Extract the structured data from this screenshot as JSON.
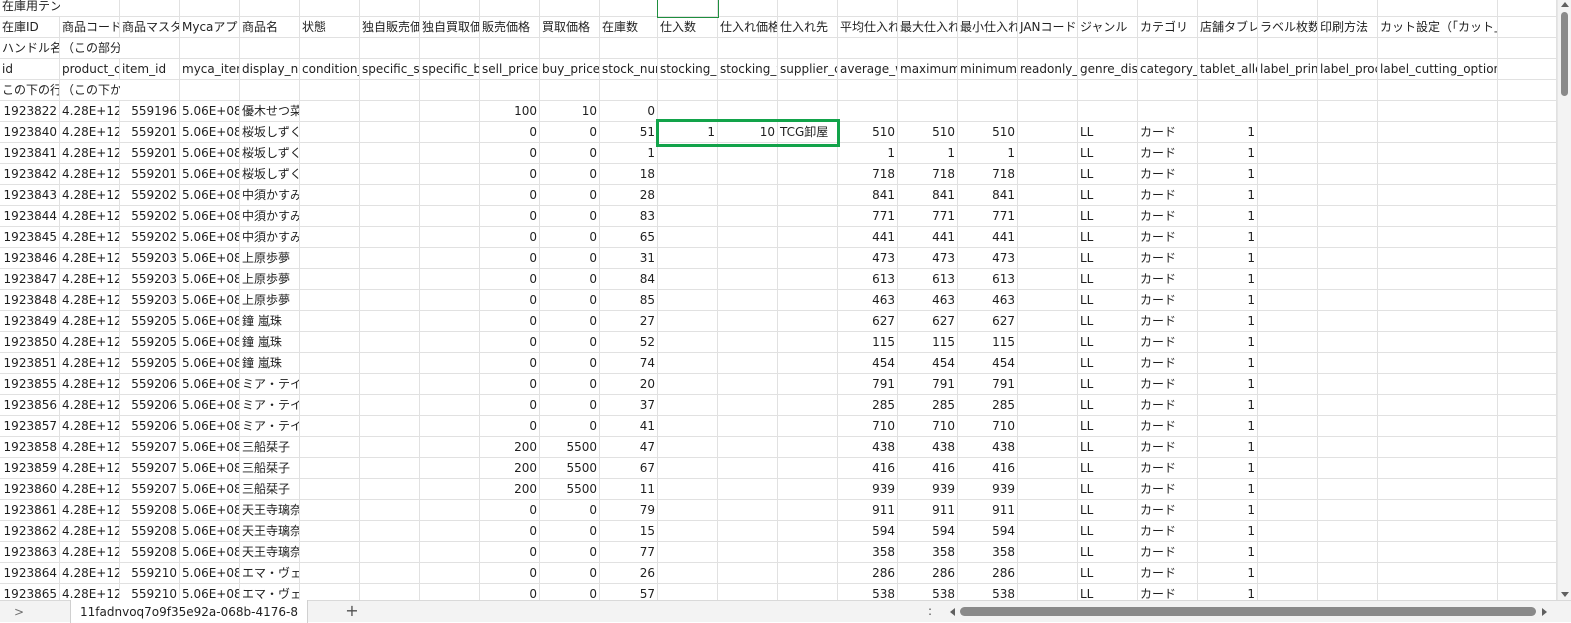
{
  "sheet": {
    "title_row": "在庫用テンプレート",
    "header_ja": [
      "在庫ID",
      "商品コード",
      "商品マスタ",
      "Mycaアプ",
      "商品名",
      "状態",
      "独自販売価",
      "独自買取価",
      "販売価格",
      "買取価格",
      "在庫数",
      "仕入数",
      "仕入れ価格",
      "仕入れ先",
      "平均仕入れ",
      "最大仕入れ",
      "最小仕入れ",
      "JANコード",
      "ジャンル",
      "カテゴリ",
      "店舗タブレ",
      "ラベル枚数",
      "印刷方法",
      "カット設定（「カット」と入力"
    ],
    "handle_row": [
      "ハンドル名",
      "（この部分は変更しないでください）"
    ],
    "header_en": [
      "id",
      "product_c",
      "item_id",
      "myca_item",
      "display_na",
      "condition_",
      "specific_s",
      "specific_b",
      "sell_price",
      "buy_price",
      "stock_num",
      "stocking_i",
      "stocking_v",
      "supplier_c",
      "average_w",
      "maximum_",
      "minimum_",
      "readonly_p",
      "genre_disp",
      "category_c",
      "tablet_allo",
      "label_prin",
      "label_proc",
      "label_cutting_option"
    ],
    "instruction_row": [
      "この下の行",
      "（この下からデータを記入してください）"
    ],
    "rows": [
      [
        "1923822",
        "4.28E+12",
        "559196",
        "5.06E+08",
        "優木せつ菜",
        "",
        "",
        "",
        "100",
        "10",
        "0",
        "",
        "",
        "",
        "",
        "",
        "",
        "",
        "",
        "",
        "",
        "",
        "",
        ""
      ],
      [
        "1923840",
        "4.28E+12",
        "559201",
        "5.06E+08",
        "桜坂しずく",
        "",
        "",
        "",
        "0",
        "0",
        "51",
        "1",
        "10",
        "TCG卸屋",
        "510",
        "510",
        "510",
        "",
        "LL",
        "カード",
        "1",
        "",
        "",
        ""
      ],
      [
        "1923841",
        "4.28E+12",
        "559201",
        "5.06E+08",
        "桜坂しずく",
        "",
        "",
        "",
        "0",
        "0",
        "1",
        "",
        "",
        "",
        "1",
        "1",
        "1",
        "",
        "LL",
        "カード",
        "1",
        "",
        "",
        ""
      ],
      [
        "1923842",
        "4.28E+12",
        "559201",
        "5.06E+08",
        "桜坂しずく",
        "",
        "",
        "",
        "0",
        "0",
        "18",
        "",
        "",
        "",
        "718",
        "718",
        "718",
        "",
        "LL",
        "カード",
        "1",
        "",
        "",
        ""
      ],
      [
        "1923843",
        "4.28E+12",
        "559202",
        "5.06E+08",
        "中須かすみ",
        "",
        "",
        "",
        "0",
        "0",
        "28",
        "",
        "",
        "",
        "841",
        "841",
        "841",
        "",
        "LL",
        "カード",
        "1",
        "",
        "",
        ""
      ],
      [
        "1923844",
        "4.28E+12",
        "559202",
        "5.06E+08",
        "中須かすみ",
        "",
        "",
        "",
        "0",
        "0",
        "83",
        "",
        "",
        "",
        "771",
        "771",
        "771",
        "",
        "LL",
        "カード",
        "1",
        "",
        "",
        ""
      ],
      [
        "1923845",
        "4.28E+12",
        "559202",
        "5.06E+08",
        "中須かすみ",
        "",
        "",
        "",
        "0",
        "0",
        "65",
        "",
        "",
        "",
        "441",
        "441",
        "441",
        "",
        "LL",
        "カード",
        "1",
        "",
        "",
        ""
      ],
      [
        "1923846",
        "4.28E+12",
        "559203",
        "5.06E+08",
        "上原歩夢",
        "",
        "",
        "",
        "0",
        "0",
        "31",
        "",
        "",
        "",
        "473",
        "473",
        "473",
        "",
        "LL",
        "カード",
        "1",
        "",
        "",
        ""
      ],
      [
        "1923847",
        "4.28E+12",
        "559203",
        "5.06E+08",
        "上原歩夢",
        "",
        "",
        "",
        "0",
        "0",
        "84",
        "",
        "",
        "",
        "613",
        "613",
        "613",
        "",
        "LL",
        "カード",
        "1",
        "",
        "",
        ""
      ],
      [
        "1923848",
        "4.28E+12",
        "559203",
        "5.06E+08",
        "上原歩夢",
        "",
        "",
        "",
        "0",
        "0",
        "85",
        "",
        "",
        "",
        "463",
        "463",
        "463",
        "",
        "LL",
        "カード",
        "1",
        "",
        "",
        ""
      ],
      [
        "1923849",
        "4.28E+12",
        "559205",
        "5.06E+08",
        "鐘 嵐珠",
        "",
        "",
        "",
        "0",
        "0",
        "27",
        "",
        "",
        "",
        "627",
        "627",
        "627",
        "",
        "LL",
        "カード",
        "1",
        "",
        "",
        ""
      ],
      [
        "1923850",
        "4.28E+12",
        "559205",
        "5.06E+08",
        "鐘 嵐珠",
        "",
        "",
        "",
        "0",
        "0",
        "52",
        "",
        "",
        "",
        "115",
        "115",
        "115",
        "",
        "LL",
        "カード",
        "1",
        "",
        "",
        ""
      ],
      [
        "1923851",
        "4.28E+12",
        "559205",
        "5.06E+08",
        "鐘 嵐珠",
        "",
        "",
        "",
        "0",
        "0",
        "74",
        "",
        "",
        "",
        "454",
        "454",
        "454",
        "",
        "LL",
        "カード",
        "1",
        "",
        "",
        ""
      ],
      [
        "1923855",
        "4.28E+12",
        "559206",
        "5.06E+08",
        "ミア・テイラー",
        "",
        "",
        "",
        "0",
        "0",
        "20",
        "",
        "",
        "",
        "791",
        "791",
        "791",
        "",
        "LL",
        "カード",
        "1",
        "",
        "",
        ""
      ],
      [
        "1923856",
        "4.28E+12",
        "559206",
        "5.06E+08",
        "ミア・テイラー",
        "",
        "",
        "",
        "0",
        "0",
        "37",
        "",
        "",
        "",
        "285",
        "285",
        "285",
        "",
        "LL",
        "カード",
        "1",
        "",
        "",
        ""
      ],
      [
        "1923857",
        "4.28E+12",
        "559206",
        "5.06E+08",
        "ミア・テイラー",
        "",
        "",
        "",
        "0",
        "0",
        "41",
        "",
        "",
        "",
        "710",
        "710",
        "710",
        "",
        "LL",
        "カード",
        "1",
        "",
        "",
        ""
      ],
      [
        "1923858",
        "4.28E+12",
        "559207",
        "5.06E+08",
        "三船栞子",
        "",
        "",
        "",
        "200",
        "5500",
        "47",
        "",
        "",
        "",
        "438",
        "438",
        "438",
        "",
        "LL",
        "カード",
        "1",
        "",
        "",
        ""
      ],
      [
        "1923859",
        "4.28E+12",
        "559207",
        "5.06E+08",
        "三船栞子",
        "",
        "",
        "",
        "200",
        "5500",
        "67",
        "",
        "",
        "",
        "416",
        "416",
        "416",
        "",
        "LL",
        "カード",
        "1",
        "",
        "",
        ""
      ],
      [
        "1923860",
        "4.28E+12",
        "559207",
        "5.06E+08",
        "三船栞子",
        "",
        "",
        "",
        "200",
        "5500",
        "11",
        "",
        "",
        "",
        "939",
        "939",
        "939",
        "",
        "LL",
        "カード",
        "1",
        "",
        "",
        ""
      ],
      [
        "1923861",
        "4.28E+12",
        "559208",
        "5.06E+08",
        "天王寺璃奈",
        "",
        "",
        "",
        "0",
        "0",
        "79",
        "",
        "",
        "",
        "911",
        "911",
        "911",
        "",
        "LL",
        "カード",
        "1",
        "",
        "",
        ""
      ],
      [
        "1923862",
        "4.28E+12",
        "559208",
        "5.06E+08",
        "天王寺璃奈",
        "",
        "",
        "",
        "0",
        "0",
        "15",
        "",
        "",
        "",
        "594",
        "594",
        "594",
        "",
        "LL",
        "カード",
        "1",
        "",
        "",
        ""
      ],
      [
        "1923863",
        "4.28E+12",
        "559208",
        "5.06E+08",
        "天王寺璃奈",
        "",
        "",
        "",
        "0",
        "0",
        "77",
        "",
        "",
        "",
        "358",
        "358",
        "358",
        "",
        "LL",
        "カード",
        "1",
        "",
        "",
        ""
      ],
      [
        "1923864",
        "4.28E+12",
        "559210",
        "5.06E+08",
        "エマ・ヴェルデ",
        "",
        "",
        "",
        "0",
        "0",
        "26",
        "",
        "",
        "",
        "286",
        "286",
        "286",
        "",
        "LL",
        "カード",
        "1",
        "",
        "",
        ""
      ],
      [
        "1923865",
        "4.28E+12",
        "559210",
        "5.06E+08",
        "エマ・ヴェルデ",
        "",
        "",
        "",
        "0",
        "0",
        "57",
        "",
        "",
        "",
        "538",
        "538",
        "538",
        "",
        "LL",
        "カード",
        "1",
        "",
        "",
        ""
      ]
    ]
  },
  "tabs": {
    "prev_label": ">",
    "sheet_name": "11fadnvoq7o9f35e92a-068b-4176-8",
    "add_label": "+",
    "more_label": ":"
  },
  "colors": {
    "selection": "#12a34a",
    "grid": "#e1e1e1"
  }
}
